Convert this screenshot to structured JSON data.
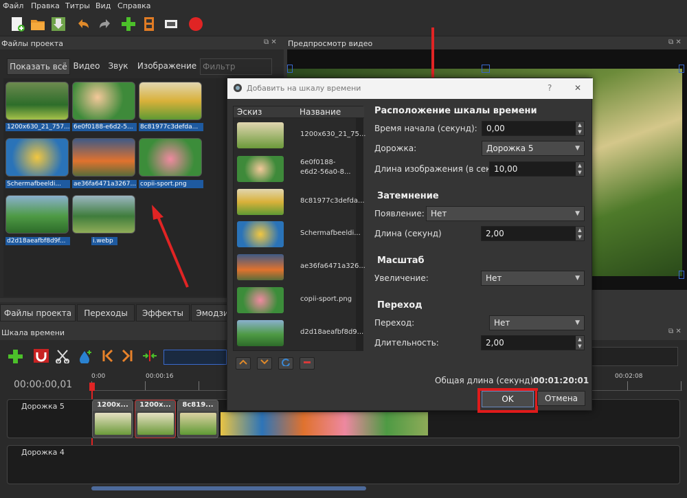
{
  "menu": [
    "Файл",
    "Правка",
    "Титры",
    "Вид",
    "Справка"
  ],
  "panels": {
    "files_title": "Файлы проекта",
    "preview_title": "Предпросмотр видео",
    "timeline_title": "Шкала времени"
  },
  "filter": {
    "show_all": "Показать всё",
    "video": "Видео",
    "audio": "Звук",
    "image": "Изображение",
    "placeholder": "Фильтр"
  },
  "files": [
    "1200x630_21_757...",
    "6e0f0188-e6d2-5...",
    "8c81977c3defda...",
    "Schermafbeeldi...",
    "ae36fa6471a3267...",
    "copii-sport.png",
    "d2d18aeafbf8d9f...",
    "i.webp"
  ],
  "tabs": [
    "Файлы проекта",
    "Переходы",
    "Эффекты",
    "Эмодзи"
  ],
  "timeline": {
    "timecode": "00:00:00,01",
    "ticks": [
      "0:00",
      "00:00:16",
      "00:02:08"
    ],
    "tracks": [
      "Дорожка 5",
      "Дорожка 4"
    ],
    "clips": [
      "1200x...",
      "1200x...",
      "8c819..."
    ]
  },
  "dialog": {
    "title": "Добавить на шкалу времени",
    "help": "?",
    "close": "✕",
    "col_thumb": "Эскиз",
    "col_name": "Название",
    "items": [
      "1200x630_21_75...",
      "6e0f0188-\ne6d2-56a0-8...",
      "8c81977c3defda...",
      "Schermafbeeldi...",
      "ae36fa6471a326...",
      "copii-sport.png",
      "d2d18aeafbf8d9..."
    ],
    "sec_position": "Расположение шкалы времени",
    "start_label": "Время начала (секунд):",
    "start_value": "0,00",
    "track_label": "Дорожка:",
    "track_value": "Дорожка 5",
    "length_label": "Длина изображения (в секу",
    "length_value": "10,00",
    "sec_fade": "Затемнение",
    "fade_in_label": "Появление:",
    "fade_in_value": "Нет",
    "fade_len_label": "Длина (секунд)",
    "fade_len_value": "2,00",
    "sec_scale": "Масштаб",
    "zoom_label": "Увеличение:",
    "zoom_value": "Нет",
    "sec_transition": "Переход",
    "transition_label": "Переход:",
    "transition_value": "Нет",
    "duration_label": "Длительность:",
    "duration_value": "2,00",
    "total_label": "Общая длина (секунд):",
    "total_value": "00:01:20:01",
    "ok": "OK",
    "cancel": "Отмена"
  },
  "colors": {
    "highlight": "#e01b1b",
    "selection": "#1e5aa0",
    "panel": "#353535"
  }
}
